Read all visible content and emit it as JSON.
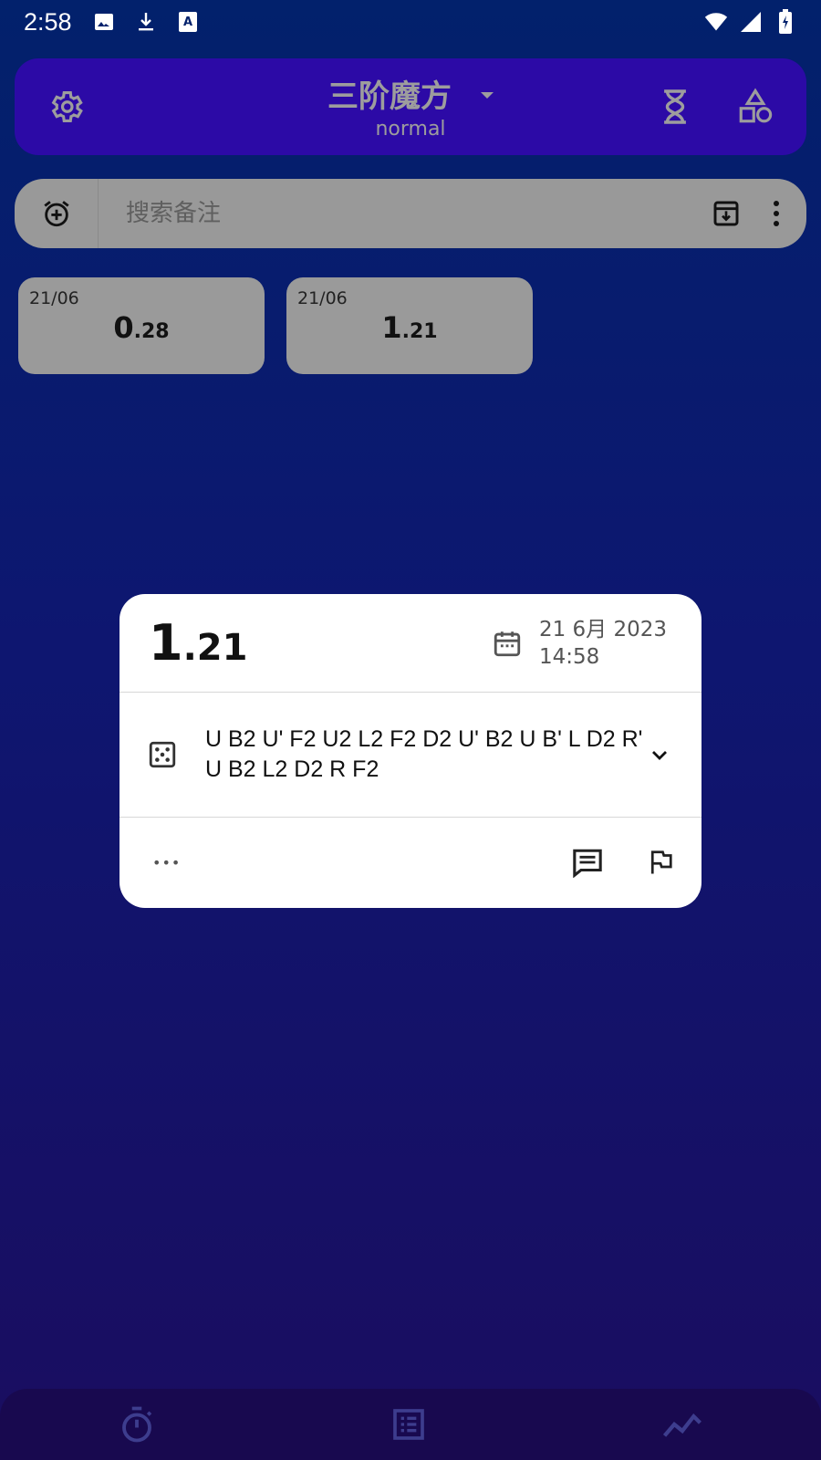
{
  "status_bar": {
    "time": "2:58",
    "left_icons": [
      "image-icon",
      "download-icon",
      "text-a-icon"
    ],
    "right_icons": [
      "wifi-icon",
      "signal-icon",
      "battery-icon"
    ]
  },
  "header": {
    "puzzle_name": "三阶魔方",
    "mode": "normal",
    "icons": [
      "gear-icon",
      "hourglass-icon",
      "shapes-icon"
    ]
  },
  "search": {
    "placeholder": "搜索备注",
    "icons": [
      "alarm-add-icon",
      "archive-download-icon",
      "more-vert-icon"
    ]
  },
  "solves": [
    {
      "date": "21/06",
      "time_int": "0",
      "time_dec": ".28"
    },
    {
      "date": "21/06",
      "time_int": "1",
      "time_dec": ".21"
    }
  ],
  "dialog": {
    "time_int": "1",
    "time_dec": ".21",
    "date_line1": "21 6月 2023",
    "date_line2": "14:58",
    "scramble": "U B2 U' F2 U2 L2 F2 D2 U' B2 U B' L D2 R' U B2 L2 D2 R F2",
    "more_label": "•••",
    "icons": [
      "calendar-icon",
      "dice-icon",
      "chevron-down-icon",
      "comment-icon",
      "flag-icon"
    ]
  },
  "bottom_nav": {
    "items": [
      "timer-icon",
      "list-icon",
      "stats-icon"
    ]
  },
  "colors": {
    "header_bg": "#2c0aa6",
    "background_top": "#02216c",
    "background_bottom": "#1a0d60"
  }
}
